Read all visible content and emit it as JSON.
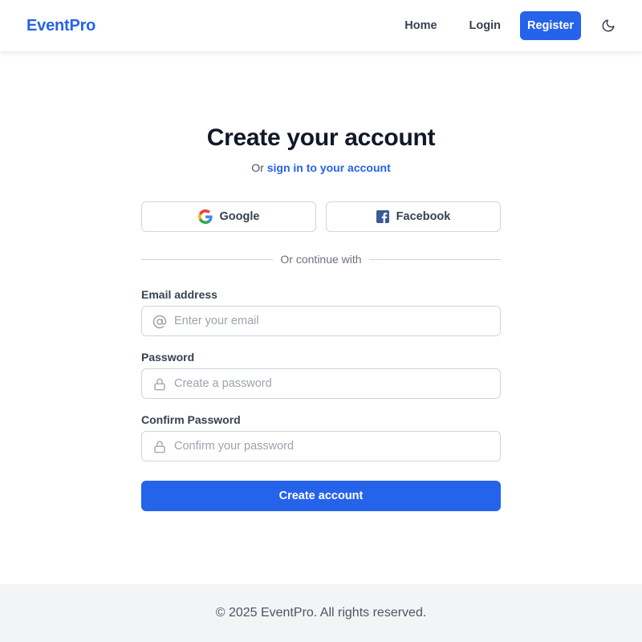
{
  "header": {
    "brand": "EventPro",
    "nav": {
      "home": "Home",
      "login": "Login",
      "register": "Register"
    },
    "theme_toggle_icon": "moon-icon"
  },
  "main": {
    "title": "Create your account",
    "subtitle_prefix": "Or",
    "subtitle_link": "sign in to your account",
    "social": {
      "google": {
        "label": "Google",
        "icon": "google-icon"
      },
      "facebook": {
        "label": "Facebook",
        "icon": "facebook-icon"
      }
    },
    "divider_text": "Or continue with",
    "form": {
      "email": {
        "label": "Email address",
        "placeholder": "Enter your email",
        "value": "",
        "icon": "at-sign-icon"
      },
      "password": {
        "label": "Password",
        "placeholder": "Create a password",
        "value": "",
        "icon": "lock-icon"
      },
      "confirm_password": {
        "label": "Confirm Password",
        "placeholder": "Confirm your password",
        "value": "",
        "icon": "lock-icon"
      },
      "submit_label": "Create account"
    }
  },
  "footer": {
    "text": "© 2025 EventPro. All rights reserved."
  },
  "colors": {
    "accent": "#2563eb",
    "heading": "#111827",
    "muted": "#6b7280",
    "border": "#d1d5db",
    "footer_bg": "#f3f4f6",
    "facebook": "#3b5998"
  }
}
